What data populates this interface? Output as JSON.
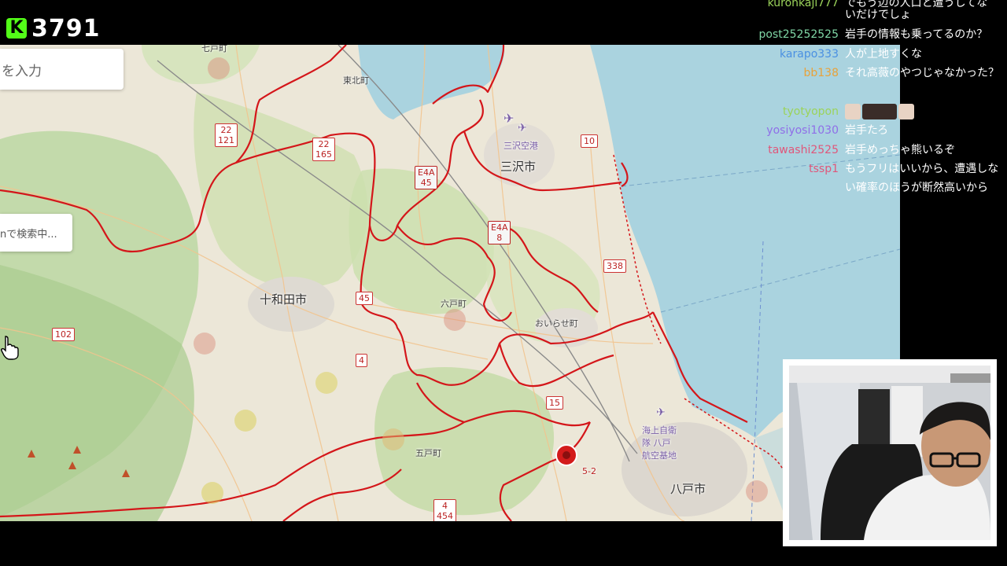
{
  "stream": {
    "viewer_count": "3791",
    "platform_logo": "K",
    "brand_color": "#53fc18"
  },
  "map": {
    "search_placeholder": "を入力",
    "search_status": "nで検索中...",
    "places": {
      "shichinohe": "七戸町",
      "tohoku": "東北町",
      "misawa": "三沢市",
      "misawa_airport": "三沢空港",
      "towada": "十和田市",
      "rokunohe": "六戸町",
      "oirase": "おいらせ町",
      "gonohe": "五戸町",
      "hachinohe": "八戸市",
      "jsdf_1": "海上自衛",
      "jsdf_2": "隊 八戸",
      "jsdf_3": "航空基地"
    },
    "roads": {
      "r1": "22",
      "r1b": "121",
      "r2": "22",
      "r2b": "165",
      "r3": "E4A",
      "r3b": "45",
      "r4": "E4A",
      "r4b": "8",
      "r5": "10",
      "r6": "338",
      "r7": "45",
      "r8": "102",
      "r9": "4",
      "r10": "15",
      "r11": "4",
      "r11b": "454",
      "r12": "5-2"
    }
  },
  "chat": {
    "messages": [
      {
        "user": "kurohkaji777",
        "color": "#9bd35a",
        "text": "でもう辺の人口と遭うしてな"
      },
      {
        "user": "",
        "color": "#ffffff",
        "text": "いだけでしょ"
      },
      {
        "user": "post25252525",
        "color": "#7fd6a5",
        "text": "岩手の情報も乗ってるのか？"
      },
      {
        "user": "karapo333",
        "color": "#4a90e2",
        "text": "人が上地すくな"
      },
      {
        "user": "bb138",
        "color": "#e8a23a",
        "text": "それ高薇のやつじゃなかった？"
      },
      {
        "user": "tyotyopon",
        "color": "#9bd35a",
        "text": ""
      },
      {
        "user": "yosiyosi1030",
        "color": "#8f6ee8",
        "text": "岩手たろ"
      },
      {
        "user": "tawashi2525",
        "color": "#e0567a",
        "text": "岩手めっちゃ熊いるぞ"
      },
      {
        "user": "tssp1",
        "color": "#e0567a",
        "text": "もうフリはいいから、遭遇しない確率のほうが断然高いから"
      }
    ]
  },
  "icons": {
    "cursor": "hand-pointer-icon",
    "marker": "red-location-marker-icon",
    "airport": "airplane-icon",
    "emote": "emote-image-icon"
  }
}
